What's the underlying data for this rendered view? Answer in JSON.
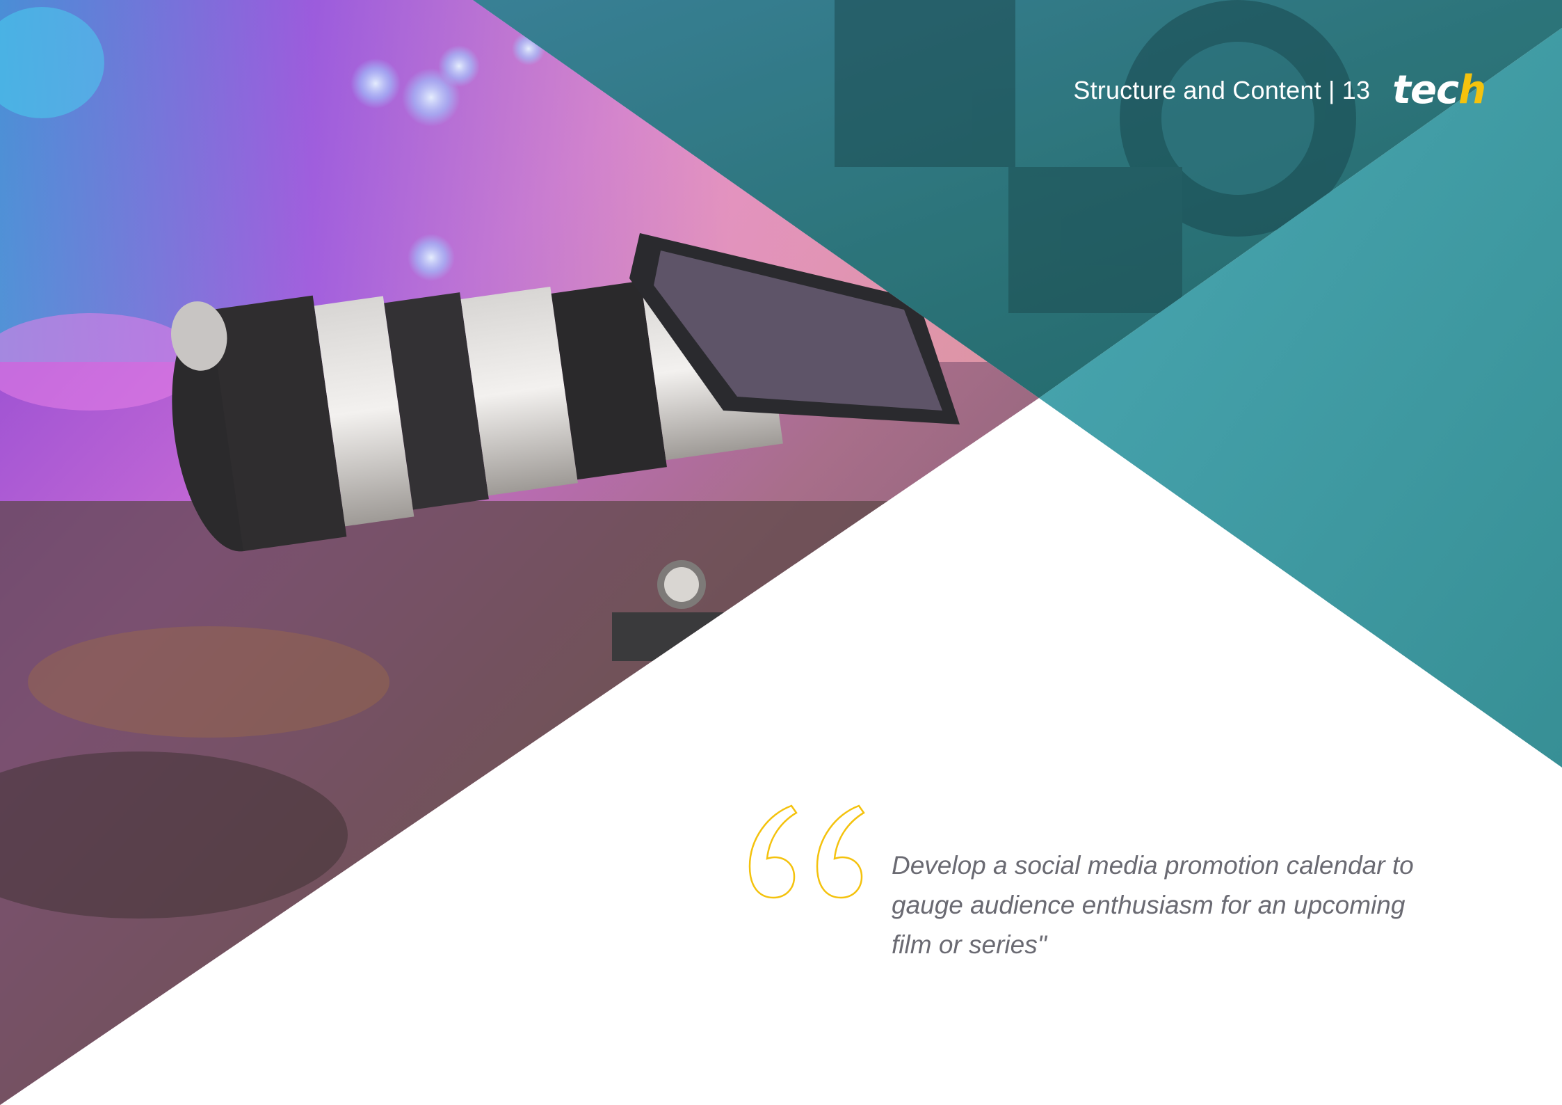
{
  "header": {
    "section_title": "Structure and Content | 13",
    "logo_text": "tech"
  },
  "quote": {
    "text": "Develop a social media promotion calendar to gauge audience enthusiasm for an upcoming film or series\""
  },
  "colors": {
    "teal": "#3f9aa2",
    "quote_mark": "#f4c20d",
    "quote_text": "#6a6a72",
    "background": "#ffffff"
  },
  "icons": {
    "quote_mark": "open-quote-icon"
  }
}
